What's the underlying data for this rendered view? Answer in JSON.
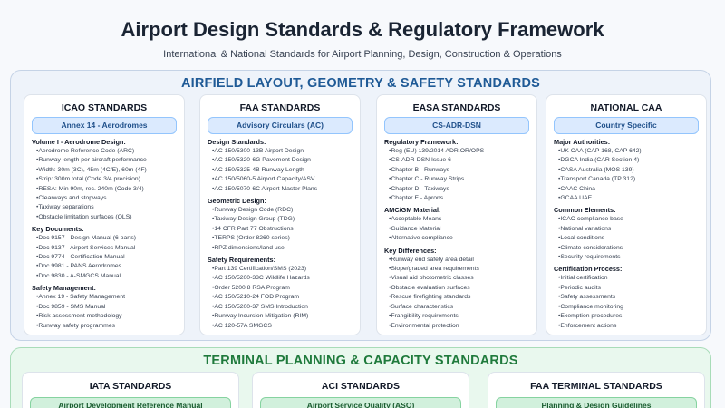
{
  "header": {
    "title": "Airport Design Standards & Regulatory Framework",
    "subtitle": "International & National Standards for Airport Planning, Design, Construction & Operations"
  },
  "airfield": {
    "title": "AIRFIELD LAYOUT, GEOMETRY & SAFETY STANDARDS",
    "cards": [
      {
        "title": "ICAO STANDARDS",
        "pill": "Annex 14 - Aerodromes",
        "groups": [
          {
            "title": "Volume I - Aerodrome Design:",
            "items": [
              "Aerodrome Reference Code (ARC)",
              "Runway length per aircraft performance",
              "Width: 30m (3C), 45m (4C/E), 60m (4F)",
              "Strip: 300m total (Code 3/4 precision)",
              "RESA: Min 90m, rec. 240m (Code 3/4)",
              "Clearways and stopways",
              "Taxiway separations",
              "Obstacle limitation surfaces (OLS)"
            ]
          },
          {
            "title": "Key Documents:",
            "items": [
              "Doc 9157 - Design Manual (6 parts)",
              "Doc 9137 - Airport Services Manual",
              "Doc 9774 - Certification Manual",
              "Doc 9981 - PANS Aerodromes",
              "Doc 9830 - A-SMGCS Manual"
            ]
          },
          {
            "title": "Safety Management:",
            "items": [
              "Annex 19 - Safety Management",
              "Doc 9859 - SMS Manual",
              "Risk assessment methodology",
              "Runway safety programmes"
            ]
          }
        ]
      },
      {
        "title": "FAA STANDARDS",
        "pill": "Advisory Circulars (AC)",
        "groups": [
          {
            "title": "Design Standards:",
            "items": [
              "AC 150/5300-13B Airport Design",
              "AC 150/5320-6G Pavement Design",
              "AC 150/5325-4B Runway Length",
              "AC 150/5060-5 Airport Capacity/ASV",
              "AC 150/5070-6C Airport Master Plans"
            ]
          },
          {
            "title": "Geometric Design:",
            "items": [
              "Runway Design Code (RDC)",
              "Taxiway Design Group (TDG)",
              "14 CFR Part 77 Obstructions",
              "TERPS (Order 8260 series)",
              "RPZ dimensions/land use"
            ]
          },
          {
            "title": "Safety Requirements:",
            "items": [
              "Part 139 Certification/SMS (2023)",
              "AC 150/5200-33C Wildlife Hazards",
              "Order 5200.8 RSA Program",
              "AC 150/5210-24 FOD Program",
              "AC 150/5200-37 SMS Introduction",
              "Runway Incursion Mitigation (RIM)",
              "AC 120-57A SMGCS"
            ]
          }
        ]
      },
      {
        "title": "EASA STANDARDS",
        "pill": "CS-ADR-DSN",
        "groups": [
          {
            "title": "Regulatory Framework:",
            "items": [
              "Reg (EU) 139/2014 ADR.OR/OPS",
              "CS-ADR-DSN Issue 6",
              "Chapter B - Runways",
              "Chapter C - Runway Strips",
              "Chapter D - Taxiways",
              "Chapter E - Aprons"
            ]
          },
          {
            "title": "AMC/GM Material:",
            "items": [
              "Acceptable Means",
              "Guidance Material",
              "Alternative compliance"
            ]
          },
          {
            "title": "Key Differences:",
            "items": [
              "Runway end safety area detail",
              "Slope/graded area requirements",
              "Visual aid photometric classes",
              "Obstacle evaluation surfaces",
              "Rescue firefighting standards",
              "Surface characteristics",
              "Frangibility requirements",
              "Environmental protection"
            ]
          }
        ]
      },
      {
        "title": "NATIONAL CAA",
        "pill": "Country Specific",
        "groups": [
          {
            "title": "Major Authorities:",
            "items": [
              "UK CAA (CAP 168, CAP 642)",
              "DGCA India (CAR Section 4)",
              "CASA Australia (MOS 139)",
              "Transport Canada (TP 312)",
              "CAAC China",
              "GCAA UAE"
            ]
          },
          {
            "title": "Common Elements:",
            "items": [
              "ICAO compliance base",
              "National variations",
              "Local conditions",
              "Climate considerations",
              "Security requirements"
            ]
          },
          {
            "title": "Certification Process:",
            "items": [
              "Initial certification",
              "Periodic audits",
              "Safety assessments",
              "Compliance monitoring",
              "Exemption procedures",
              "Enforcement actions"
            ]
          }
        ]
      }
    ]
  },
  "terminal": {
    "title": "TERMINAL PLANNING & CAPACITY STANDARDS",
    "cards": [
      {
        "title": "IATA STANDARDS",
        "pill": "Airport Development Reference Manual"
      },
      {
        "title": "ACI STANDARDS",
        "pill": "Airport Service Quality (ASQ)"
      },
      {
        "title": "FAA TERMINAL STANDARDS",
        "pill": "Planning & Design Guidelines"
      }
    ]
  }
}
